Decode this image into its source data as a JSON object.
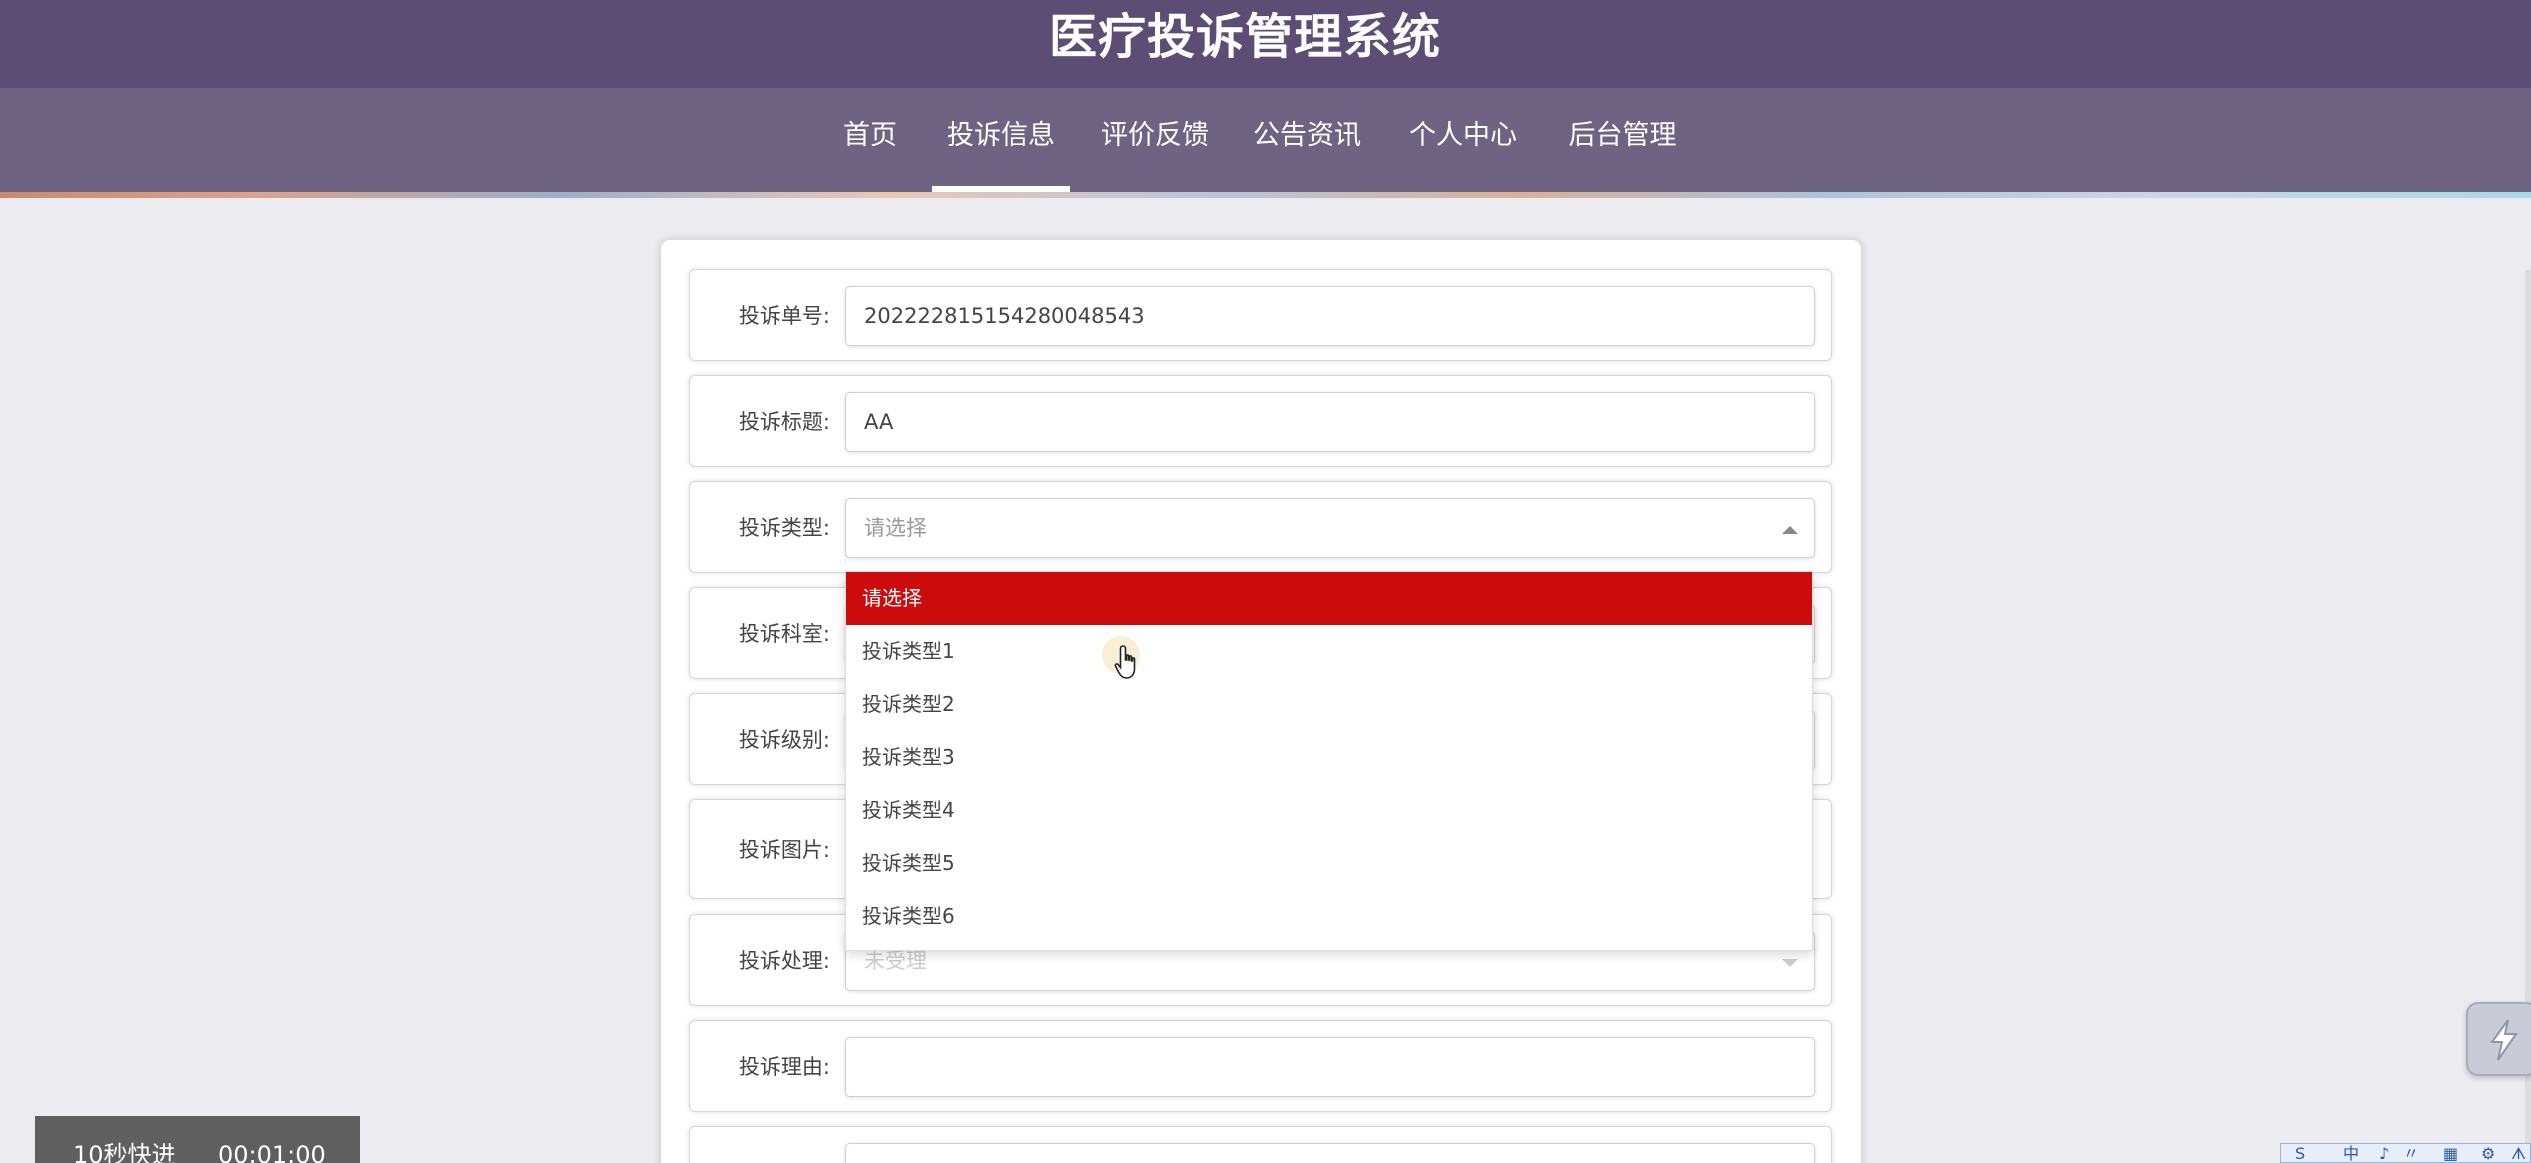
{
  "header": {
    "title": "医疗投诉管理系统"
  },
  "nav": {
    "items": [
      {
        "label": "首页"
      },
      {
        "label": "投诉信息"
      },
      {
        "label": "评价反馈"
      },
      {
        "label": "公告资讯"
      },
      {
        "label": "个人中心"
      },
      {
        "label": "后台管理"
      }
    ],
    "active": "投诉信息"
  },
  "form": {
    "complaint_no": {
      "label": "投诉单号:",
      "value": "2022228151542800485 43"
    },
    "complaint_title": {
      "label": "投诉标题:",
      "value": "AA"
    },
    "complaint_type": {
      "label": "投诉类型:",
      "value": "请选择"
    },
    "complaint_dept": {
      "label": "投诉科室:"
    },
    "complaint_level": {
      "label": "投诉级别:"
    },
    "complaint_image": {
      "label": "投诉图片:"
    },
    "complaint_handling": {
      "label": "投诉处理:",
      "value": "未受理"
    },
    "complaint_reason": {
      "label": "投诉理由:",
      "value": ""
    }
  },
  "dropdown": {
    "options": [
      {
        "label": "请选择",
        "selected": true
      },
      {
        "label": "投诉类型1"
      },
      {
        "label": "投诉类型2"
      },
      {
        "label": "投诉类型3"
      },
      {
        "label": "投诉类型4"
      },
      {
        "label": "投诉类型5"
      },
      {
        "label": "投诉类型6"
      }
    ]
  },
  "timer": {
    "label": "10秒快进",
    "value": "00:01:00"
  },
  "ime": {
    "items": [
      "S",
      "中",
      "♪",
      "〃",
      "▦",
      "⚙",
      "ᗑ"
    ]
  },
  "colors": {
    "header_bg": "#5c4d75",
    "nav_bg": "#6e6382",
    "selected_option": "#cc0c0c"
  }
}
